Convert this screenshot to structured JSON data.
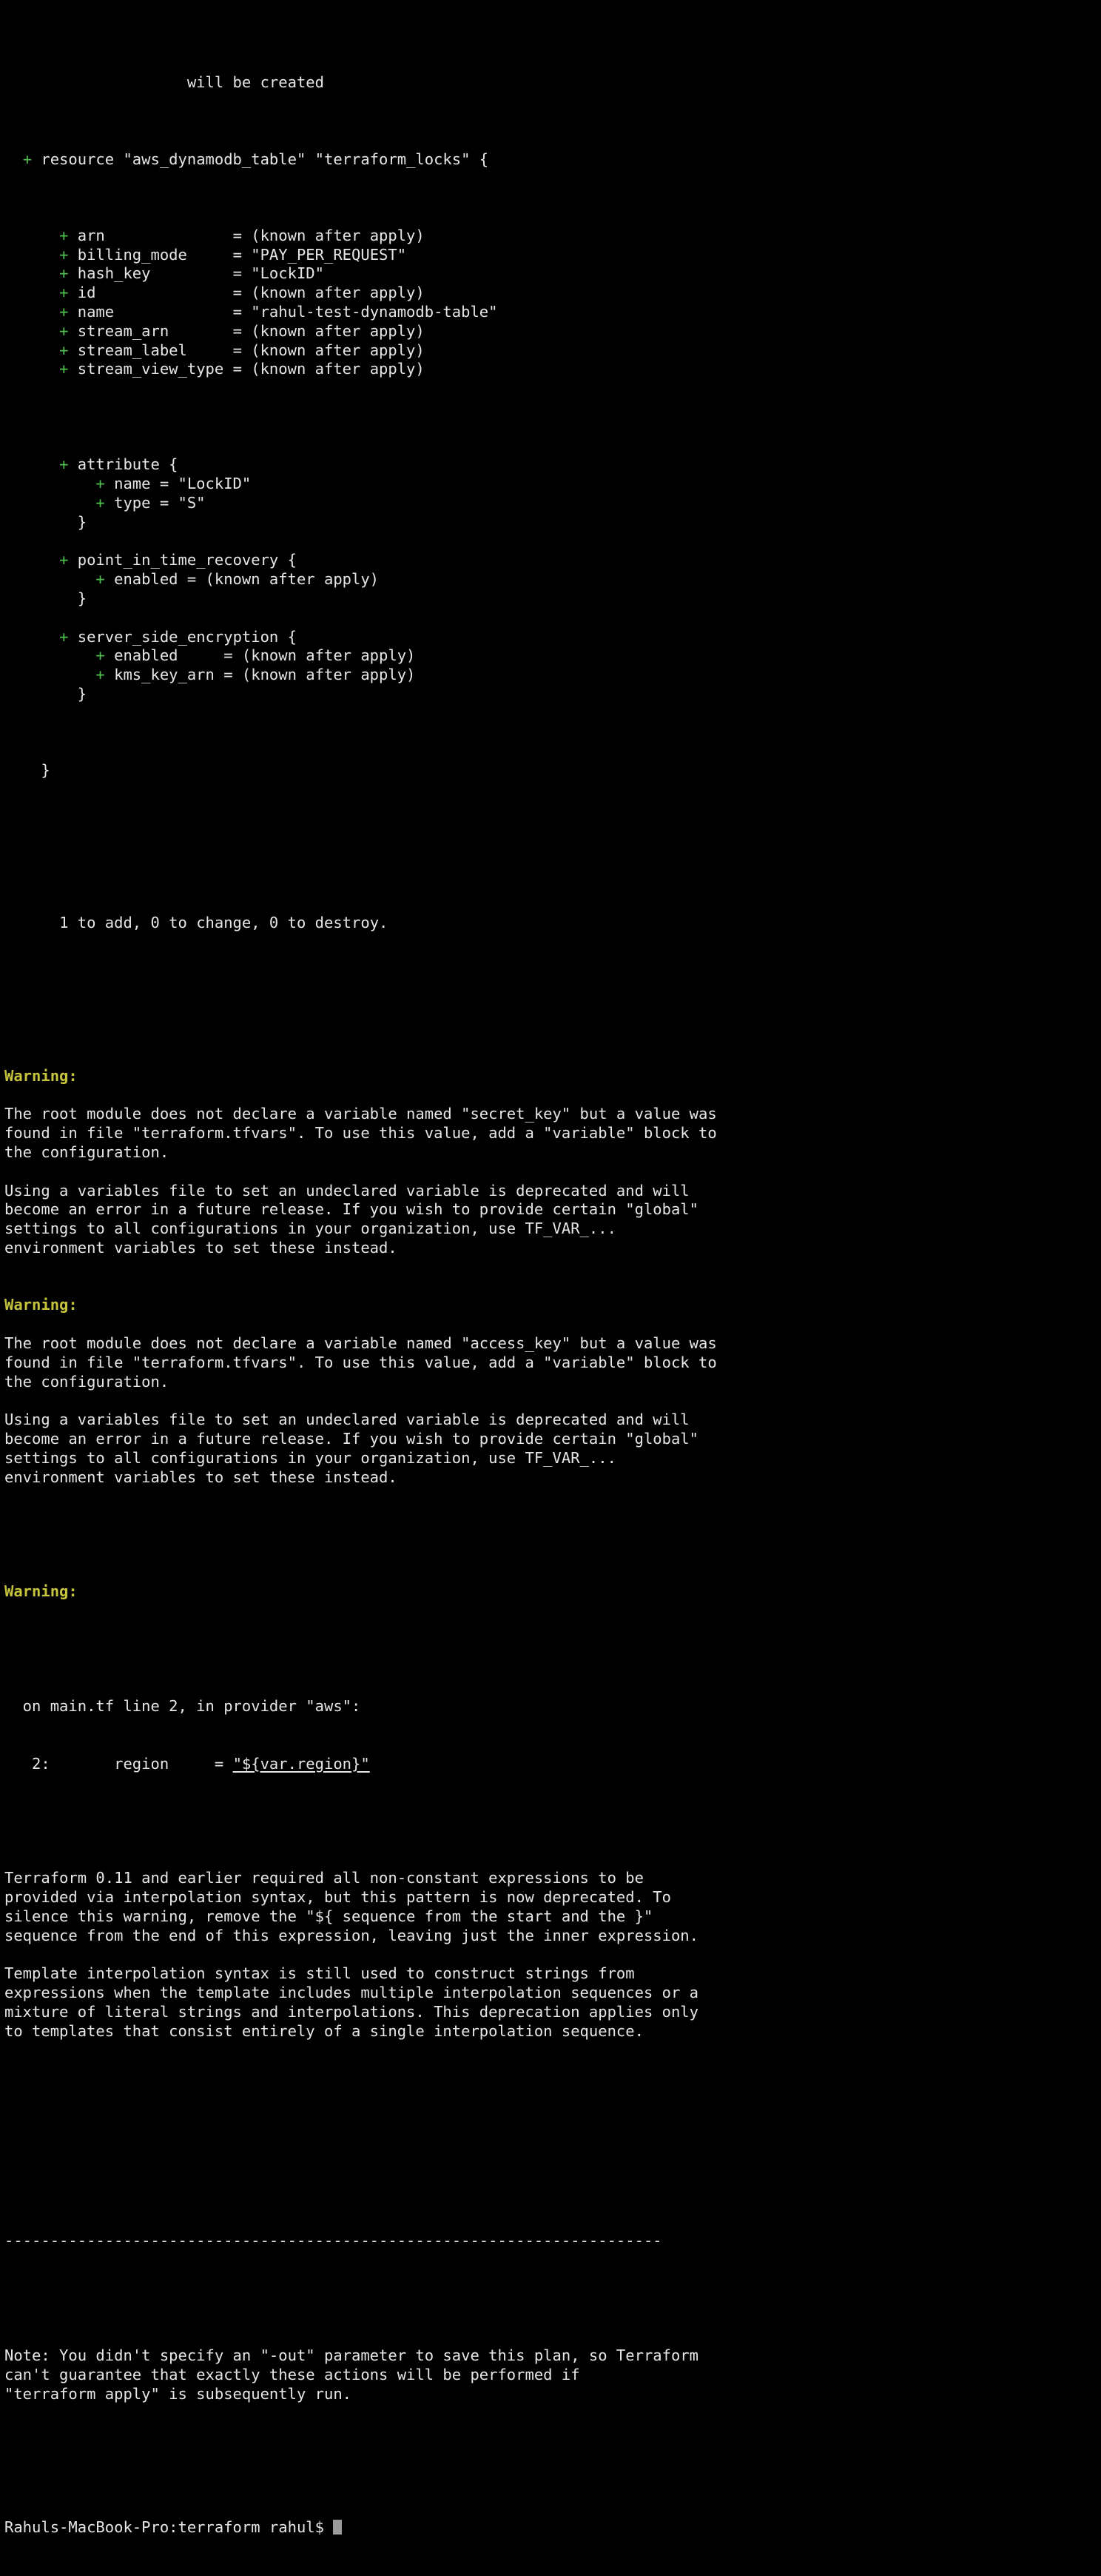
{
  "terminal": {
    "background_color": "#000000",
    "foreground_color": "#e6e6e6",
    "plus_color": "#4fc14f",
    "warning_color": "#c6c43c",
    "cursor_color": "#9a9a9a",
    "title": "terraform plan output"
  },
  "plan": {
    "header_line": "                    will be created",
    "resource_line_plus": "+",
    "resource_line_text": " resource \"aws_dynamodb_table\" \"terraform_locks\" {",
    "attributes": [
      {
        "plus": "+",
        "text": " arn              = (known after apply)"
      },
      {
        "plus": "+",
        "text": " billing_mode     = \"PAY_PER_REQUEST\""
      },
      {
        "plus": "+",
        "text": " hash_key         = \"LockID\""
      },
      {
        "plus": "+",
        "text": " id               = (known after apply)"
      },
      {
        "plus": "+",
        "text": " name             = \"rahul-test-dynamodb-table\""
      },
      {
        "plus": "+",
        "text": " stream_arn       = (known after apply)"
      },
      {
        "plus": "+",
        "text": " stream_label     = (known after apply)"
      },
      {
        "plus": "+",
        "text": " stream_view_type = (known after apply)"
      }
    ],
    "blocks": [
      {
        "open_plus": "+",
        "open_text": " attribute {",
        "lines": [
          {
            "plus": "+",
            "text": " name = \"LockID\""
          },
          {
            "plus": "+",
            "text": " type = \"S\""
          }
        ],
        "close_text": "}"
      },
      {
        "open_plus": "+",
        "open_text": " point_in_time_recovery {",
        "lines": [
          {
            "plus": "+",
            "text": " enabled = (known after apply)"
          }
        ],
        "close_text": "}"
      },
      {
        "open_plus": "+",
        "open_text": " server_side_encryption {",
        "lines": [
          {
            "plus": "+",
            "text": " enabled     = (known after apply)"
          },
          {
            "plus": "+",
            "text": " kms_key_arn = (known after apply)"
          }
        ],
        "close_text": "}"
      }
    ],
    "resource_close": "}",
    "summary": "1 to add, 0 to change, 0 to destroy."
  },
  "warnings": [
    {
      "label": "Warning:",
      "paragraphs": [
        [
          "The root module does not declare a variable named \"secret_key\" but a value was",
          "found in file \"terraform.tfvars\". To use this value, add a \"variable\" block to",
          "the configuration."
        ],
        [
          "Using a variables file to set an undeclared variable is deprecated and will",
          "become an error in a future release. If you wish to provide certain \"global\"",
          "settings to all configurations in your organization, use TF_VAR_...",
          "environment variables to set these instead."
        ]
      ]
    },
    {
      "label": "Warning:",
      "paragraphs": [
        [
          "The root module does not declare a variable named \"access_key\" but a value was",
          "found in file \"terraform.tfvars\". To use this value, add a \"variable\" block to",
          "the configuration."
        ],
        [
          "Using a variables file to set an undeclared variable is deprecated and will",
          "become an error in a future release. If you wish to provide certain \"global\"",
          "settings to all configurations in your organization, use TF_VAR_...",
          "environment variables to set these instead."
        ]
      ]
    }
  ],
  "warning_third": {
    "label": "Warning:",
    "source_line": "  on main.tf line 2, in provider \"aws\":",
    "code_line_prefix": "   2:       region     = ",
    "code_line_highlight": "\"${var.region}\"",
    "paragraphs": [
      [
        "Terraform 0.11 and earlier required all non-constant expressions to be",
        "provided via interpolation syntax, but this pattern is now deprecated. To",
        "silence this warning, remove the \"${ sequence from the start and the }\"",
        "sequence from the end of this expression, leaving just the inner expression."
      ],
      [
        "Template interpolation syntax is still used to construct strings from",
        "expressions when the template includes multiple interpolation sequences or a",
        "mixture of literal strings and interpolations. This deprecation applies only",
        "to templates that consist entirely of a single interpolation sequence."
      ]
    ]
  },
  "footer": {
    "divider": "------------------------------------------------------------------------",
    "note_lines": [
      "Note: You didn't specify an \"-out\" parameter to save this plan, so Terraform",
      "can't guarantee that exactly these actions will be performed if",
      "\"terraform apply\" is subsequently run."
    ]
  },
  "prompt": {
    "text": "Rahuls-MacBook-Pro:terraform rahul$ "
  }
}
